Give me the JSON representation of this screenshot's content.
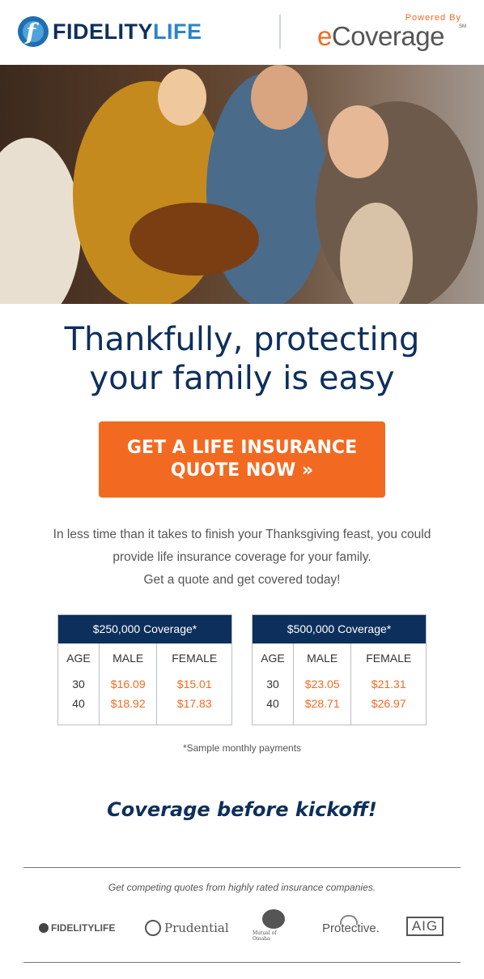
{
  "header": {
    "fl_logo_part1": "FIDELITY",
    "fl_logo_part2": "LIFE",
    "fl_mark": "f",
    "eco_powered": "Powered By",
    "eco_e": "e",
    "eco_rest": "Coverage",
    "eco_sm": "SM"
  },
  "headline": {
    "line1": "Thankfully, protecting",
    "line2": "your family is easy"
  },
  "cta": {
    "label": "GET A LIFE INSURANCE QUOTE NOW »"
  },
  "body": {
    "line1": "In less time than it takes to finish your Thanksgiving feast, you could",
    "line2": "provide life insurance coverage for your family.",
    "line3": "Get a quote and get covered today!"
  },
  "tables": [
    {
      "title": "$250,000 Coverage*",
      "columns": [
        "AGE",
        "MALE",
        "FEMALE"
      ],
      "rows": [
        [
          "30",
          "$16.09",
          "$15.01"
        ],
        [
          "40",
          "$18.92",
          "$17.83"
        ]
      ]
    },
    {
      "title": "$500,000 Coverage*",
      "columns": [
        "AGE",
        "MALE",
        "FEMALE"
      ],
      "rows": [
        [
          "30",
          "$23.05",
          "$21.31"
        ],
        [
          "40",
          "$28.71",
          "$26.97"
        ]
      ]
    }
  ],
  "sample_note": "*Sample monthly payments",
  "kickoff": "Coverage before kickoff!",
  "compete": "Get competing quotes from highly rated insurance companies.",
  "partners": {
    "fidelity": "FIDELITYLIFE",
    "prudential": "Prudential",
    "mutual": "Mutual of Omaha",
    "protective": "Protective.",
    "aig": "AIG"
  },
  "colors": {
    "navy": "#0d2f5c",
    "orange": "#f26a21"
  }
}
